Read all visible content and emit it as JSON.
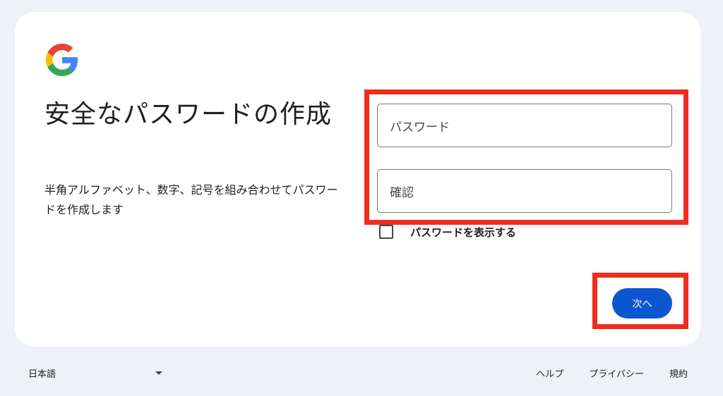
{
  "brand": {
    "logo_icon": "google-g-logo",
    "colors": {
      "blue": "#4285F4",
      "red": "#EA4335",
      "yellow": "#FBBC05",
      "green": "#34A853"
    }
  },
  "page": {
    "title": "安全なパスワードの作成",
    "subtitle": "半角アルファベット、数字、記号を組み合わせてパスワードを作成します"
  },
  "form": {
    "password_label": "パスワード",
    "confirm_label": "確認",
    "show_password_label": "パスワードを表示する",
    "show_password_checked": false,
    "next_label": "次へ"
  },
  "footer": {
    "language": "日本語",
    "links": [
      "ヘルプ",
      "プライバシー",
      "規約"
    ]
  },
  "accent_color": "#0b57d0",
  "highlight_color": "#ee2d1f"
}
